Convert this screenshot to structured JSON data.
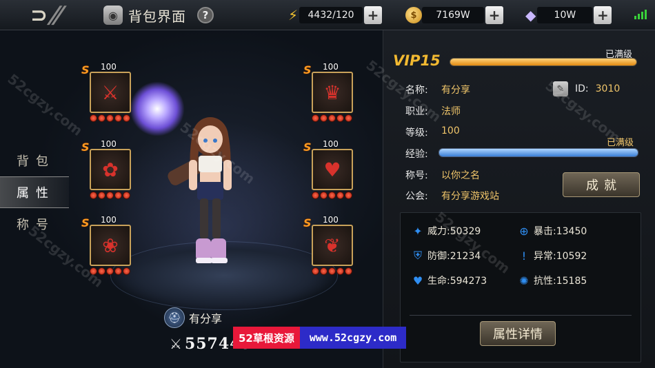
{
  "header": {
    "page_title": "背包界面",
    "help_symbol": "?",
    "energy": "4432/120",
    "gold": "7169W",
    "diamonds": "10W",
    "plus_symbol": "+"
  },
  "side_tabs": [
    {
      "label": "背包",
      "active": false
    },
    {
      "label": "属性",
      "active": true
    },
    {
      "label": "称号",
      "active": false
    }
  ],
  "equipment": [
    {
      "grade": "S",
      "level": "100",
      "stars": 5,
      "icon": "weapon-icon"
    },
    {
      "grade": "S",
      "level": "100",
      "stars": 5,
      "icon": "hat-icon"
    },
    {
      "grade": "S",
      "level": "100",
      "stars": 5,
      "icon": "skirt-icon"
    },
    {
      "grade": "S",
      "level": "100",
      "stars": 5,
      "icon": "armor-icon"
    },
    {
      "grade": "S",
      "level": "100",
      "stars": 5,
      "icon": "belt-icon"
    },
    {
      "grade": "S",
      "level": "100",
      "stars": 5,
      "icon": "boots-icon"
    }
  ],
  "hero": {
    "name": "有分享",
    "power": "557449"
  },
  "profile": {
    "vip_label": "VIP15",
    "vip_maxed": "已满级",
    "vip_progress": 1.0,
    "name_label": "名称:",
    "name_value": "有分享",
    "id_label": "ID:",
    "id_value": "3010",
    "class_label": "职业:",
    "class_value": "法师",
    "level_label": "等级:",
    "level_value": "100",
    "exp_label": "经验:",
    "exp_maxed": "已满级",
    "exp_progress": 1.0,
    "title_label": "称号:",
    "title_value": "以你之名",
    "guild_label": "公会:",
    "guild_value": "有分享游戏站",
    "achievement_button": "成就"
  },
  "stats": {
    "power": "威力:50329",
    "crit": "暴击:13450",
    "defense": "防御:21234",
    "abnormal": "异常:10592",
    "life": "生命:594273",
    "resist": "抗性:15185",
    "detail_button": "属性详情"
  },
  "watermark": {
    "left": "52草根资源",
    "right": "www.52cgzy.com",
    "diagonal": "52cgzy.com"
  },
  "colors": {
    "accent_gold": "#f0c56a",
    "vip_gold": "#f2b931",
    "stat_blue": "#2f8ef2",
    "watermark_red": "#e8183a",
    "watermark_blue": "#2d2bc8"
  }
}
